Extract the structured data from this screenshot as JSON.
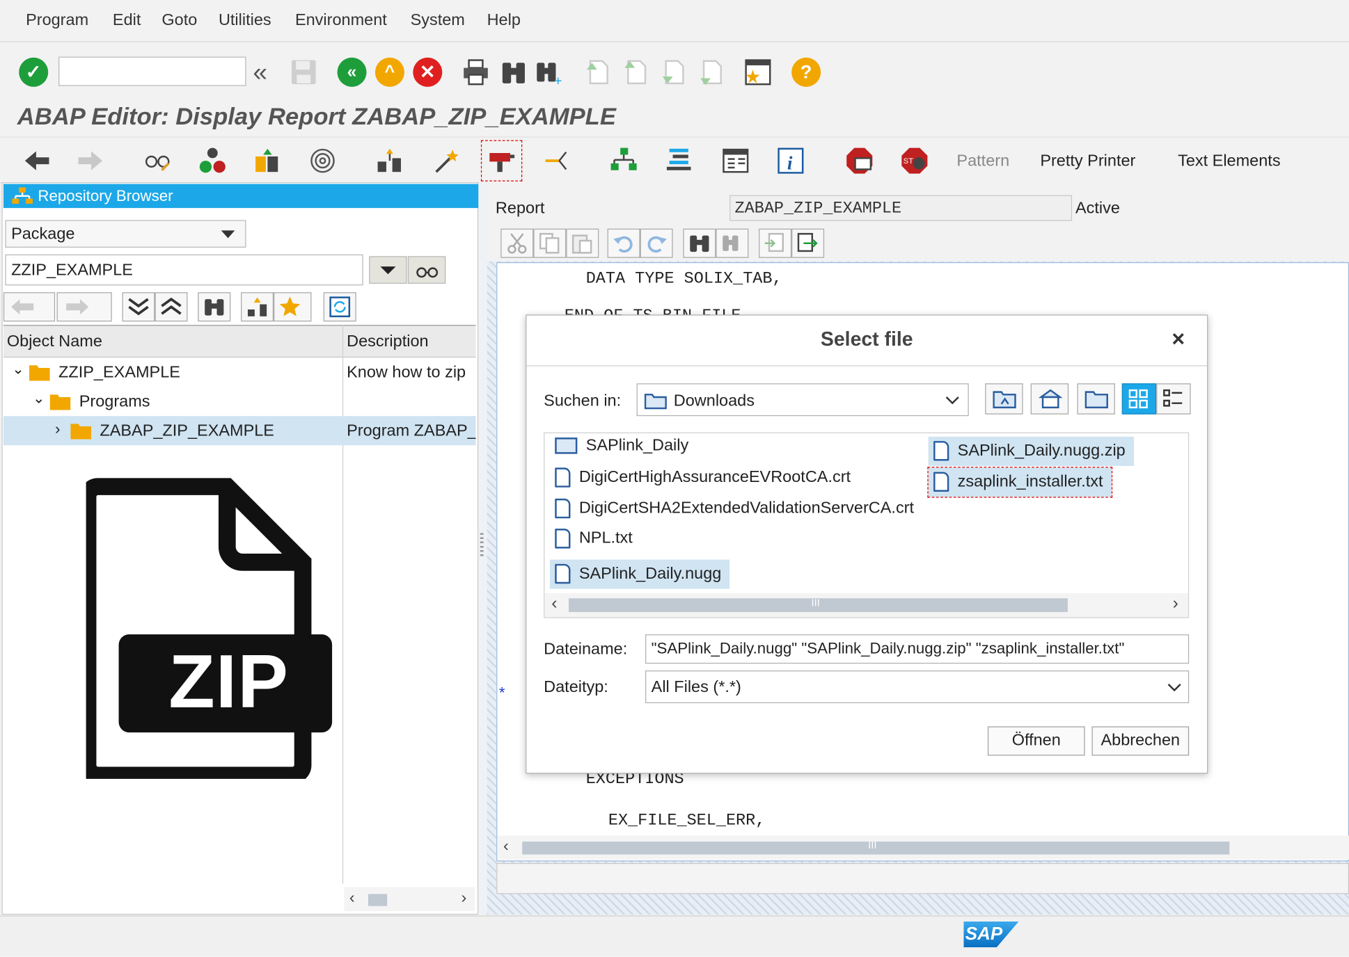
{
  "menubar": {
    "items": [
      "Program",
      "Edit",
      "Goto",
      "Utilities",
      "Environment",
      "System",
      "Help"
    ]
  },
  "toolbar": {
    "command_field_value": "",
    "back_symbol": "«"
  },
  "page_title": "ABAP Editor: Display Report ZABAP_ZIP_EXAMPLE",
  "app_toolbar": {
    "pattern_label": "Pattern",
    "pretty_printer_label": "Pretty Printer",
    "text_elements_label": "Text Elements"
  },
  "repository_browser": {
    "title": "Repository Browser",
    "object_type": "Package",
    "package_name": "ZZIP_EXAMPLE",
    "columns": [
      "Object Name",
      "Description"
    ],
    "rows": [
      {
        "name": "ZZIP_EXAMPLE",
        "description": "Know how to zip"
      },
      {
        "name": "Programs",
        "description": ""
      },
      {
        "name": "ZABAP_ZIP_EXAMPLE",
        "description": "Program ZABAP_"
      }
    ],
    "image_caption": "ZIP"
  },
  "report": {
    "label": "Report",
    "name": "ZABAP_ZIP_EXAMPLE",
    "status": "Active"
  },
  "code_lines": {
    "line1": "DATA TYPE SOLIX_TAB,",
    "line2": "END OF TS_BIN_FILE.",
    "line3": "EXCEPTIONS",
    "line4": "EX_FILE_SEL_ERR,",
    "marker": "*"
  },
  "dialog": {
    "title": "Select file",
    "close_symbol": "×",
    "look_in_label": "Suchen in:",
    "look_in_value": "Downloads",
    "files": [
      "SAPlink_Daily",
      "DigiCertHighAssuranceEVRootCA.crt",
      "DigiCertSHA2ExtendedValidationServerCA.crt",
      "NPL.txt",
      "SAPlink_Daily.nugg",
      "SAPlink_Daily.nugg.zip",
      "zsaplink_installer.txt"
    ],
    "filename_label": "Dateiname:",
    "filename_value": "\"SAPlink_Daily.nugg\" \"SAPlink_Daily.nugg.zip\" \"zsaplink_installer.txt\"",
    "filetype_label": "Dateityp:",
    "filetype_value": "All Files (*.*)",
    "open_label": "Öffnen",
    "cancel_label": "Abbrechen",
    "scroll_grip": "III"
  },
  "status": {
    "logo": "SAP"
  },
  "colors": {
    "accent": "#1ca8e8",
    "confirm": "#1e9e3a",
    "nav_orange": "#f2a700",
    "cancel_red": "#e02020",
    "selection": "#d0e4f2"
  }
}
